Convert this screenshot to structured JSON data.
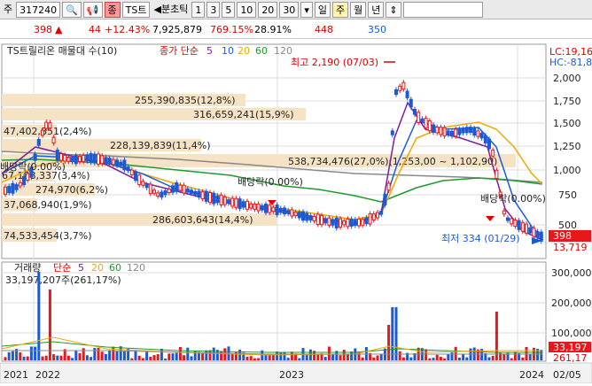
{
  "toolbar": {
    "type_label": "주",
    "code": "317240",
    "search_icon": "search-icon",
    "sound_icon": "speaker-icon",
    "badge": "종",
    "name": "TS트",
    "minute_tick_label": "◀분초틱",
    "periods": [
      "1",
      "3",
      "5",
      "10",
      "20",
      "30"
    ],
    "period_dropdown": "30",
    "day": "일",
    "week": "주",
    "month": "월",
    "year": "년",
    "sort_icon": "sort-arrows-icon"
  },
  "quote": {
    "price": "398",
    "up_arrow": "▲",
    "change": "44",
    "change_pct": "+12.43%",
    "volume": "7,925,879",
    "vol_ratio": "769.15%",
    "turnover": "28.91%",
    "v1": "448",
    "v2": "350"
  },
  "price_panel": {
    "legend_name": "TS트릴리온 매물대 수(10)",
    "ma_label": "종가 단순",
    "ma_periods": [
      "5",
      "10",
      "20",
      "60",
      "120"
    ],
    "lc": "LC:19,16",
    "hc": "HC:-81,8",
    "high_note": "최고 2,190 (07/03)",
    "low_note": "최저 334 (01/29)",
    "current_price": "398",
    "current_sub": "13,719",
    "dividend_labels": [
      "배당락(0.00%)",
      "배당락(0.00%)",
      "배당락(0.00%)"
    ],
    "price_ticks": [
      "2,000",
      "1,750",
      "1,500",
      "1,250",
      "1,000",
      "750",
      "500"
    ]
  },
  "volume_panel": {
    "title": "거래량",
    "ma_label": "단순",
    "ma_periods": [
      "5",
      "20",
      "60",
      "120"
    ],
    "max_info": "33,197,207주(261,17%)",
    "ticks": [
      "300,000",
      "200,000",
      "100,000"
    ],
    "current": "33,197",
    "current_sub": "261,17"
  },
  "x_axis": [
    "2021",
    "2022",
    "2023",
    "2024",
    "02/05"
  ],
  "volume_profile": [
    {
      "label": "255,390,835(12,8%)"
    },
    {
      "label": "316,659,241(15,9%)"
    },
    {
      "label": "47,402,851(2,4%)"
    },
    {
      "label": "228,139,839(11,4%)"
    },
    {
      "label": "538,734,476(27,0%)(1,253,00 ~ 1,102,90)"
    },
    {
      "label": "67,188,337(3,4%)"
    },
    {
      "label": "274,970(6,2%)"
    },
    {
      "label": "37,068,940(1,9%)"
    },
    {
      "label": "286,603,643(14,4%)"
    },
    {
      "label": "74,533,454(3,7%)"
    }
  ],
  "colors": {
    "up": "#e8171b",
    "down": "#1a5ad8",
    "ma5": "#7b1ea2",
    "ma10": "#1a5ad8",
    "ma20": "#f0a800",
    "ma60": "#1e9a2c",
    "ma120": "#888888",
    "profile": "#f6e2c4"
  }
}
